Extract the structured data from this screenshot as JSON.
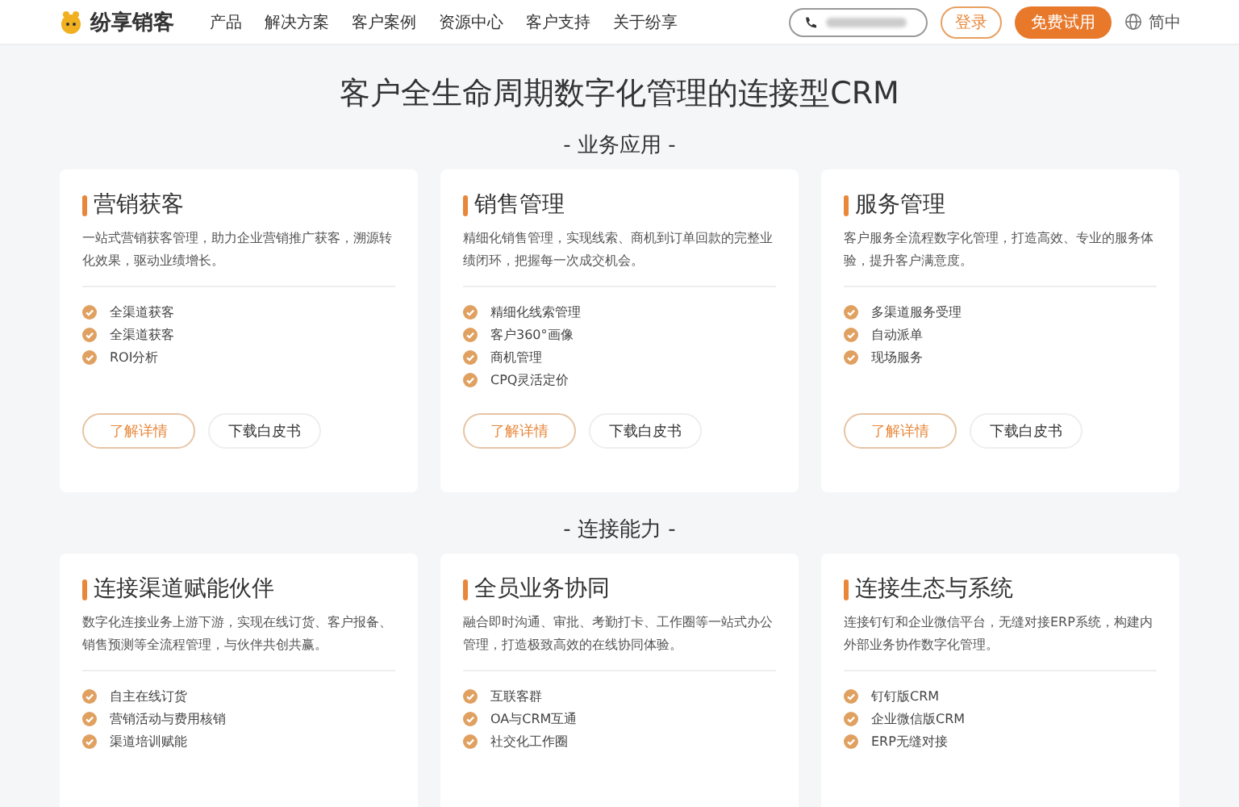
{
  "header": {
    "logo": "纷享销客",
    "nav": [
      {
        "label": "产品"
      },
      {
        "label": "解决方案"
      },
      {
        "label": "客户案例"
      },
      {
        "label": "资源中心"
      },
      {
        "label": "客户支持"
      },
      {
        "label": "关于纷享"
      }
    ],
    "login": "登录",
    "trial": "免费试用",
    "language": "简中"
  },
  "title": "客户全生命周期数字化管理的连接型CRM",
  "sections": [
    {
      "heading": "- 业务应用 -",
      "cards": [
        {
          "title": "营销获客",
          "desc": "一站式营销获客管理，助力企业营销推广获客，溯源转化效果，驱动业绩增长。",
          "features": [
            "全渠道获客",
            "全渠道获客",
            "ROI分析"
          ],
          "primary": "了解详情",
          "secondary": "下载白皮书"
        },
        {
          "title": "销售管理",
          "desc": "精细化销售管理，实现线索、商机到订单回款的完整业绩闭环，把握每一次成交机会。",
          "features": [
            "精细化线索管理",
            "客户360°画像",
            "商机管理",
            "CPQ灵活定价"
          ],
          "primary": "了解详情",
          "secondary": "下载白皮书"
        },
        {
          "title": "服务管理",
          "desc": "客户服务全流程数字化管理，打造高效、专业的服务体验，提升客户满意度。",
          "features": [
            "多渠道服务受理",
            "自动派单",
            "现场服务"
          ],
          "primary": "了解详情",
          "secondary": "下载白皮书"
        }
      ]
    },
    {
      "heading": "- 连接能力 -",
      "cards": [
        {
          "title": "连接渠道赋能伙伴",
          "desc": "数字化连接业务上游下游，实现在线订货、客户报备、销售预测等全流程管理，与伙伴共创共赢。",
          "features": [
            "自主在线订货",
            "营销活动与费用核销",
            "渠道培训赋能"
          ]
        },
        {
          "title": "全员业务协同",
          "desc": "融合即时沟通、审批、考勤打卡、工作圈等一站式办公管理，打造极致高效的在线协同体验。",
          "features": [
            "互联客群",
            "OA与CRM互通",
            "社交化工作圈"
          ]
        },
        {
          "title": "连接生态与系统",
          "desc": "连接钉钉和企业微信平台，无缝对接ERP系统，构建内外部业务协作数字化管理。",
          "features": [
            "钉钉版CRM",
            "企业微信版CRM",
            "ERP无缝对接"
          ]
        }
      ]
    }
  ]
}
